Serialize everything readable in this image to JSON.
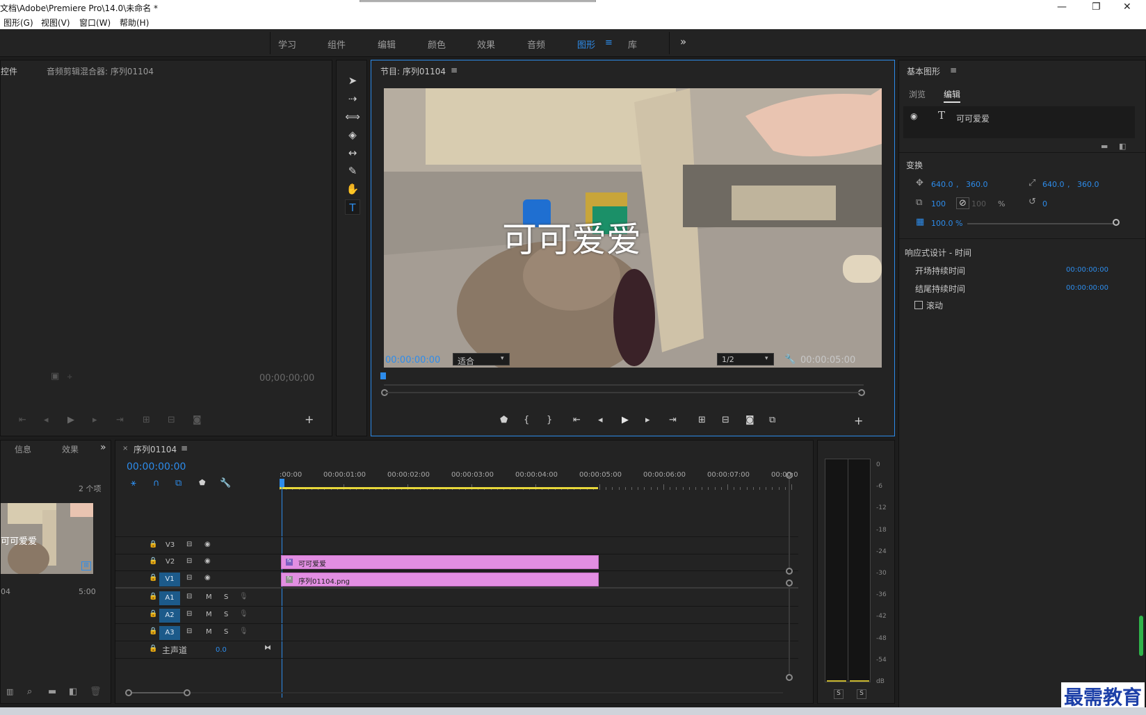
{
  "window": {
    "title": "文档\\Adobe\\Premiere Pro\\14.0\\未命名 *",
    "minimize": "—",
    "restore": "❐",
    "close": "✕"
  },
  "menu": [
    "图形(G)",
    "视图(V)",
    "窗口(W)",
    "帮助(H)"
  ],
  "workspaces": {
    "tabs": [
      "学习",
      "组件",
      "编辑",
      "颜色",
      "效果",
      "音频",
      "图形",
      "库"
    ],
    "active": "图形",
    "more": "»",
    "menu_icon": "≡"
  },
  "source_panel": {
    "tab_controls": "控件",
    "tab_audio_mixer": "音频剪辑混合器: 序列01104",
    "timecode": "00;00;00;00"
  },
  "program_monitor": {
    "title": "节目: 序列01104",
    "menu_icon": "≡",
    "overlay_text": "可可爱爱",
    "timecode_current": "00:00:00:00",
    "fit_value": "适合",
    "resolution_value": "1/2",
    "timecode_duration": "00:00:05:00",
    "add_button": "+"
  },
  "essential_graphics": {
    "title": "基本图形",
    "menu_icon": "≡",
    "tab_browse": "浏览",
    "tab_edit": "编辑",
    "layer_name": "可可爱爱",
    "section_transform": "变换",
    "position_x": "640.0",
    "position_y": "360.0",
    "anchor_x": "640.0",
    "anchor_y": "360.0",
    "scale": "100",
    "scale_locked": "100",
    "percent": "%",
    "rotation": "0",
    "opacity": "100.0 %",
    "opacity_fraction": 1.0,
    "section_responsive": "响应式设计 - 时间",
    "intro_label": "开场持续时间",
    "intro_value": "00:00:00:00",
    "outro_label": "结尾持续时间",
    "outro_value": "00:00:00:00",
    "roll_label": "滚动"
  },
  "project_panel": {
    "tab_info": "信息",
    "tab_effects": "效果",
    "more": "»",
    "item_count": "2 个项",
    "thumb_text": "可可爱爱",
    "item_name": "04",
    "item_duration": "5:00"
  },
  "timeline": {
    "close_icon": "×",
    "title": "序列01104",
    "menu_icon": "≡",
    "timecode": "00:00:00:00",
    "ruler": [
      ":00:00",
      "00:00:01:00",
      "00:00:02:00",
      "00:00:03:00",
      "00:00:04:00",
      "00:00:05:00",
      "00:00:06:00",
      "00:00:07:00",
      "00:00:0"
    ],
    "video_tracks": [
      "V3",
      "V2",
      "V1"
    ],
    "audio_tracks": [
      "A1",
      "A2",
      "A3"
    ],
    "master_label": "主声道",
    "master_value": "0.0",
    "m_label": "M",
    "s_label": "S",
    "clip_v2": "可可爱爱",
    "clip_v1": "序列01104.png"
  },
  "audio_meter": {
    "labels": [
      "0",
      "-6",
      "-12",
      "-18",
      "-24",
      "-30",
      "-36",
      "-42",
      "-48",
      "-54",
      "dB"
    ],
    "solo_left": "S",
    "solo_right": "S"
  },
  "watermark": "最需教育",
  "colors": {
    "accent": "#2d8ceb",
    "clip": "#e28ee2",
    "panel": "#232323",
    "bg": "#1d1d1d",
    "track_badge": "#1c5a8a",
    "work_area": "#e8d83a"
  }
}
